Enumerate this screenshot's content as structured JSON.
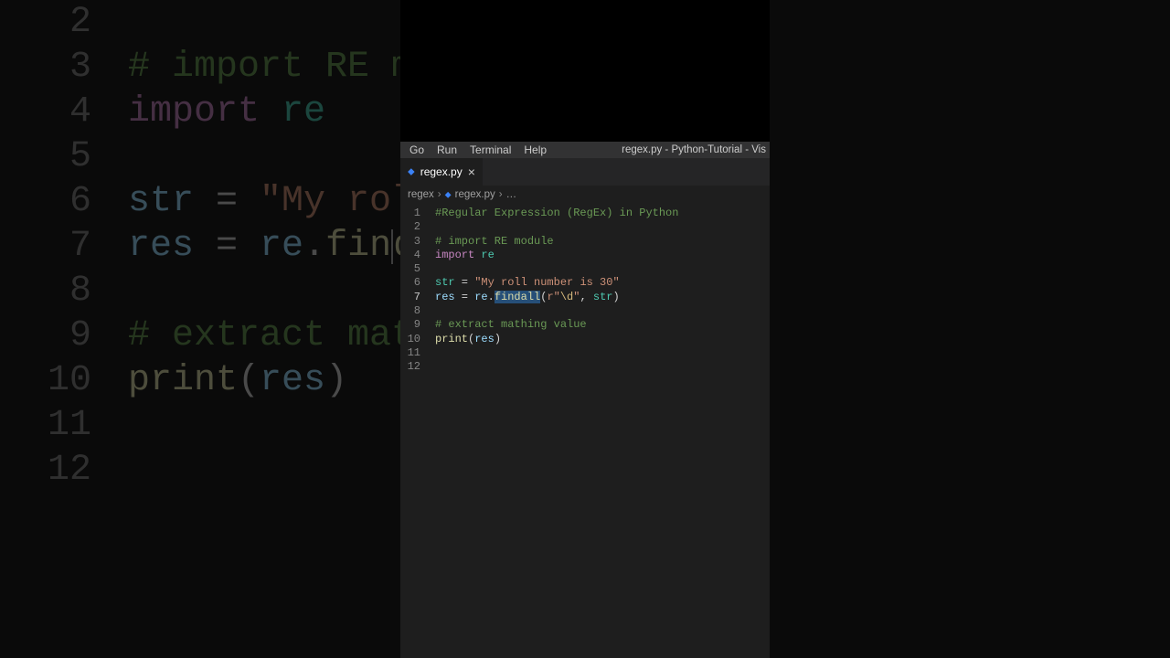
{
  "bg_code": {
    "lines": [
      {
        "num": "2",
        "tokens": [
          [
            "",
            ""
          ]
        ]
      },
      {
        "num": "3",
        "tokens": [
          [
            "bg-comment",
            "# import RE mo"
          ]
        ]
      },
      {
        "num": "4",
        "tokens": [
          [
            "bg-keyword",
            "import "
          ],
          [
            "bg-module",
            "re"
          ]
        ]
      },
      {
        "num": "5",
        "tokens": [
          [
            "",
            ""
          ]
        ]
      },
      {
        "num": "6",
        "tokens": [
          [
            "bg-var",
            "str"
          ],
          [
            "bg-paren",
            " = "
          ],
          [
            "bg-string",
            "\"My roll "
          ]
        ]
      },
      {
        "num": "7",
        "tokens": [
          [
            "bg-var",
            "res"
          ],
          [
            "bg-paren",
            " = "
          ],
          [
            "bg-var",
            "re"
          ],
          [
            "bg-paren",
            "."
          ],
          [
            "bg-func",
            "finda"
          ]
        ],
        "cursor": true
      },
      {
        "num": "8",
        "tokens": [
          [
            "",
            ""
          ]
        ]
      },
      {
        "num": "9",
        "tokens": [
          [
            "bg-comment",
            "# extract math"
          ]
        ]
      },
      {
        "num": "10",
        "tokens": [
          [
            "bg-func",
            "print"
          ],
          [
            "bg-paren",
            "("
          ],
          [
            "bg-var",
            "res"
          ],
          [
            "bg-paren",
            ")"
          ]
        ]
      },
      {
        "num": "11",
        "tokens": [
          [
            "",
            ""
          ]
        ]
      },
      {
        "num": "12",
        "tokens": [
          [
            "",
            ""
          ]
        ]
      }
    ]
  },
  "menu": {
    "go": "Go",
    "run": "Run",
    "terminal": "Terminal",
    "help": "Help"
  },
  "window_title": "regex.py - Python-Tutorial - Vis",
  "tab": {
    "name": "regex.py",
    "close": "×"
  },
  "breadcrumb": {
    "folder": "regex",
    "file": "regex.py",
    "ellipsis": "…",
    "sep": "›"
  },
  "code": {
    "lines": [
      {
        "num": "1",
        "tokens": [
          [
            "tok-comment",
            "#Regular Expression (RegEx) in Python"
          ]
        ]
      },
      {
        "num": "2",
        "tokens": [
          [
            "",
            ""
          ]
        ]
      },
      {
        "num": "3",
        "tokens": [
          [
            "tok-comment",
            "# import RE module"
          ]
        ]
      },
      {
        "num": "4",
        "tokens": [
          [
            "tok-keyword",
            "import"
          ],
          [
            "tok-op",
            " "
          ],
          [
            "tok-module",
            "re"
          ]
        ]
      },
      {
        "num": "5",
        "tokens": [
          [
            "",
            ""
          ]
        ]
      },
      {
        "num": "6",
        "tokens": [
          [
            "tok-builtin",
            "str"
          ],
          [
            "tok-op",
            " = "
          ],
          [
            "tok-string",
            "\"My roll number is 30\""
          ]
        ]
      },
      {
        "num": "7",
        "current": true,
        "tokens": [
          [
            "tok-var",
            "res"
          ],
          [
            "tok-op",
            " = "
          ],
          [
            "tok-var",
            "re"
          ],
          [
            "tok-op",
            "."
          ],
          [
            "tok-call sel",
            "findall"
          ],
          [
            "tok-paren",
            "("
          ],
          [
            "tok-string",
            "r\""
          ],
          [
            "tok-escape",
            "\\d"
          ],
          [
            "tok-string",
            "\""
          ],
          [
            "tok-punct",
            ", "
          ],
          [
            "tok-builtin",
            "str"
          ],
          [
            "tok-paren",
            ")"
          ]
        ]
      },
      {
        "num": "8",
        "tokens": [
          [
            "",
            ""
          ]
        ]
      },
      {
        "num": "9",
        "tokens": [
          [
            "tok-comment",
            "# extract mathing value"
          ]
        ]
      },
      {
        "num": "10",
        "tokens": [
          [
            "tok-call",
            "print"
          ],
          [
            "tok-paren",
            "("
          ],
          [
            "tok-var",
            "res"
          ],
          [
            "tok-paren",
            ")"
          ]
        ]
      },
      {
        "num": "11",
        "tokens": [
          [
            "",
            ""
          ]
        ]
      },
      {
        "num": "12",
        "tokens": [
          [
            "",
            ""
          ]
        ]
      }
    ]
  }
}
